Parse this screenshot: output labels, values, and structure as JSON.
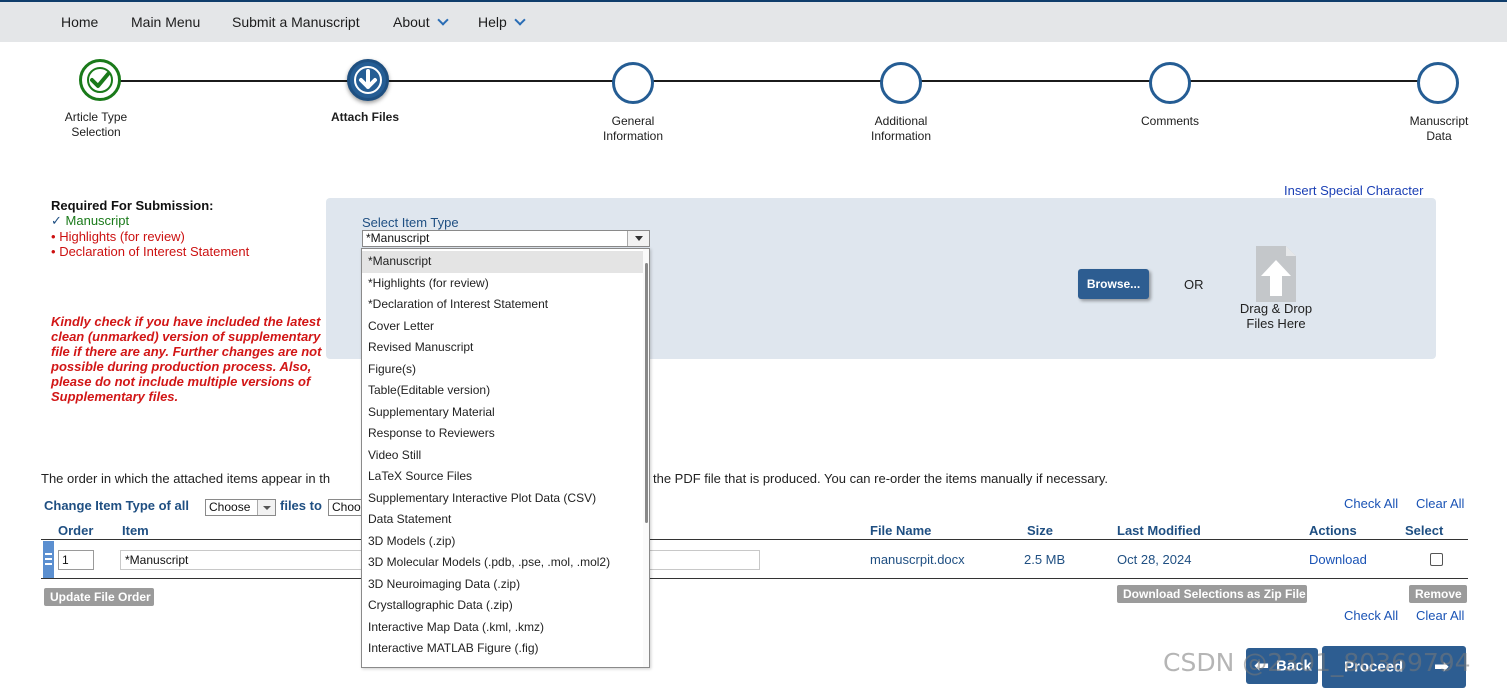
{
  "nav": {
    "home": "Home",
    "main_menu": "Main Menu",
    "submit": "Submit a Manuscript",
    "about": "About",
    "help": "Help"
  },
  "steps": [
    {
      "label": "Article Type\nSelection",
      "status": "done"
    },
    {
      "label": "Attach Files",
      "status": "current"
    },
    {
      "label": "General\nInformation",
      "status": "pending"
    },
    {
      "label": "Additional\nInformation",
      "status": "pending"
    },
    {
      "label": "Comments",
      "status": "pending"
    },
    {
      "label": "Manuscript\nData",
      "status": "pending"
    }
  ],
  "required": {
    "title": "Required For Submission:",
    "items": [
      "Manuscript",
      "Highlights (for review)",
      "Declaration of Interest Statement"
    ]
  },
  "notice": "Kindly check if you have included the latest clean (unmarked) version of supplementary file if there are any. Further changes are not possible during production process. Also, please do not include multiple versions of Supplementary files.",
  "insert_special": "Insert Special Character",
  "upload": {
    "select_label": "Select Item Type",
    "selected": "*Manuscript",
    "browse": "Browse...",
    "or": "OR",
    "drop": "Drag & Drop\nFiles Here"
  },
  "dropdown_options": [
    "*Manuscript",
    "*Highlights (for review)",
    "*Declaration of Interest Statement",
    "Cover Letter",
    "Revised Manuscript",
    "Figure(s)",
    "Table(Editable version)",
    "Supplementary Material",
    "Response to Reviewers",
    "Video Still",
    "LaTeX Source Files",
    "Supplementary Interactive Plot Data (CSV)",
    "Data Statement",
    "3D Models (.zip)",
    "3D Molecular Models (.pdb, .pse, .mol, .mol2)",
    "3D Neuroimaging Data (.zip)",
    "Crystallographic Data (.zip)",
    "Interactive Map Data (.kml, .kmz)",
    "Interactive MATLAB Figure (.fig)"
  ],
  "order_note_start": "The order in which the attached items appear in th",
  "order_note_end": "the PDF file that is produced. You can re-order the items manually if necessary.",
  "change_type": {
    "label": "Change Item Type of all",
    "choose1": "Choose",
    "files_to": "files to",
    "choose2": "Choo"
  },
  "check_all": "Check All",
  "clear_all": "Clear All",
  "table": {
    "headers": {
      "order": "Order",
      "item": "Item",
      "file_name": "File Name",
      "size": "Size",
      "last_modified": "Last Modified",
      "actions": "Actions",
      "select": "Select"
    },
    "rows": [
      {
        "order": "1",
        "item": "*Manuscript",
        "file_name": "manuscrpit.docx",
        "size": "2.5 MB",
        "last_modified": "Oct 28, 2024",
        "action": "Download"
      }
    ]
  },
  "buttons": {
    "update_order": "Update File Order",
    "download_zip": "Download Selections as Zip File",
    "remove": "Remove",
    "back": "Back",
    "proceed": "Proceed"
  },
  "watermark": "CSDN @2301_80369794",
  "colors": {
    "primary": "#2d5d91",
    "done": "#1a7a1a",
    "error": "#d21616",
    "link": "#1a53b5"
  }
}
